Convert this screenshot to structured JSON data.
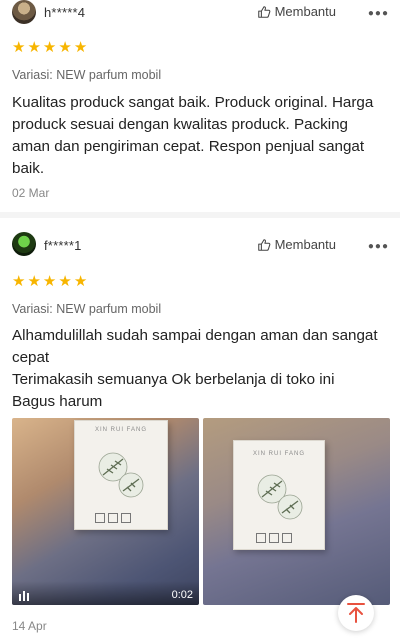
{
  "reviews": [
    {
      "username": "h*****4",
      "helpful_label": "Membantu",
      "rating": 5,
      "variation": "Variasi: NEW parfum mobil",
      "body": "Kualitas produck sangat baik. Produck original.  Harga produck sesuai dengan kwalitas produck. Packing aman dan pengiriman cepat. Respon penjual sangat baik.",
      "date": "02 Mar"
    },
    {
      "username": "f*****1",
      "helpful_label": "Membantu",
      "rating": 5,
      "variation": "Variasi: NEW parfum mobil",
      "body_lines": [
        "Alhamdulillah sudah sampai dengan aman dan sangat cepat",
        "Terimakasih semuanya Ok berbelanja di toko ini",
        "Bagus harum"
      ],
      "media": [
        {
          "type": "video",
          "duration": "0:02",
          "box_text": "XIN RUI FANG"
        },
        {
          "type": "image",
          "box_text": "XIN RUI FANG"
        }
      ],
      "date": "14 Apr"
    }
  ],
  "icons": {
    "helpful": "thumbs-up-icon",
    "more": "more-options-icon",
    "star": "star-icon",
    "video": "video-icon",
    "scroll_top": "arrow-up-icon"
  },
  "colors": {
    "star": "#f7b500",
    "scroll_top": "#e8523f"
  }
}
